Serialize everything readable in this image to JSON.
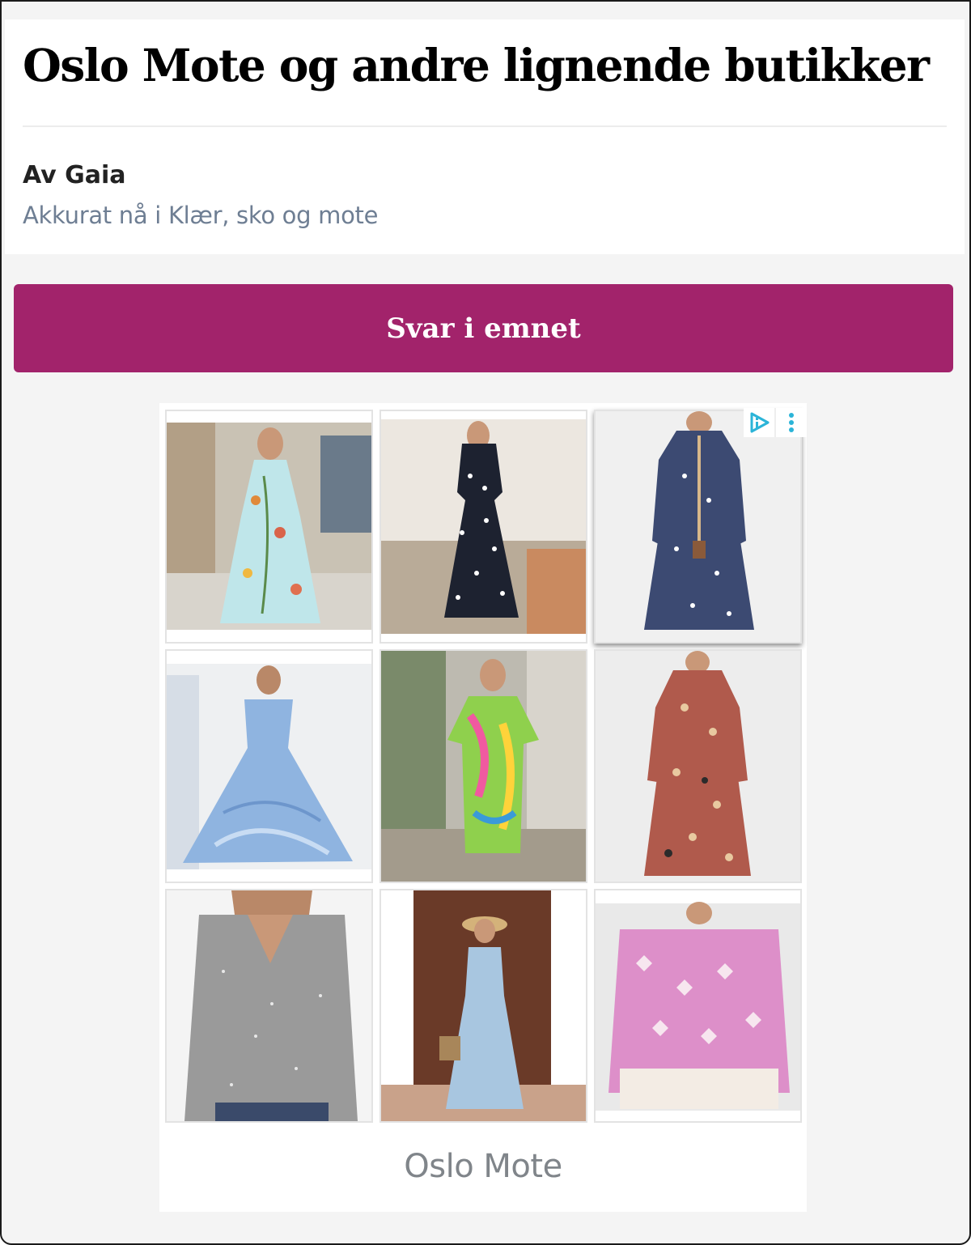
{
  "topic": {
    "title": "Oslo Mote og andre lignende butikker",
    "author": "Av Gaia",
    "meta": "Akkurat nå i Klær, sko og mote"
  },
  "actions": {
    "reply_label": "Svar i emnet"
  },
  "ad": {
    "advertiser": "Oslo Mote",
    "adchoices_icon": "adchoices-icon",
    "menu_icon": "kebab-menu-icon",
    "products": [
      {
        "icon": "floral-maxi-dress-photo",
        "color": "#bfe6ea"
      },
      {
        "icon": "polka-dot-midi-dress-photo",
        "color": "#1d2230"
      },
      {
        "icon": "blue-print-boho-dress-photo",
        "color": "#3c4a72"
      },
      {
        "icon": "blue-off-shoulder-gown-photo",
        "color": "#8fb4e0"
      },
      {
        "icon": "colorful-kaftan-dress-photo",
        "color": "#8fd04d"
      },
      {
        "icon": "red-floral-midi-dress-photo",
        "color": "#b05a4c"
      },
      {
        "icon": "silver-sequin-top-photo",
        "color": "#9a9a9a"
      },
      {
        "icon": "light-blue-lace-dress-photo",
        "color": "#a8c6e0"
      },
      {
        "icon": "pink-pattern-sweater-photo",
        "color": "#dd8fc9"
      }
    ]
  },
  "colors": {
    "accent": "#a2236b",
    "title": "#000000",
    "meta_text": "#6e7e93",
    "page_bg": "#f4f4f4"
  }
}
